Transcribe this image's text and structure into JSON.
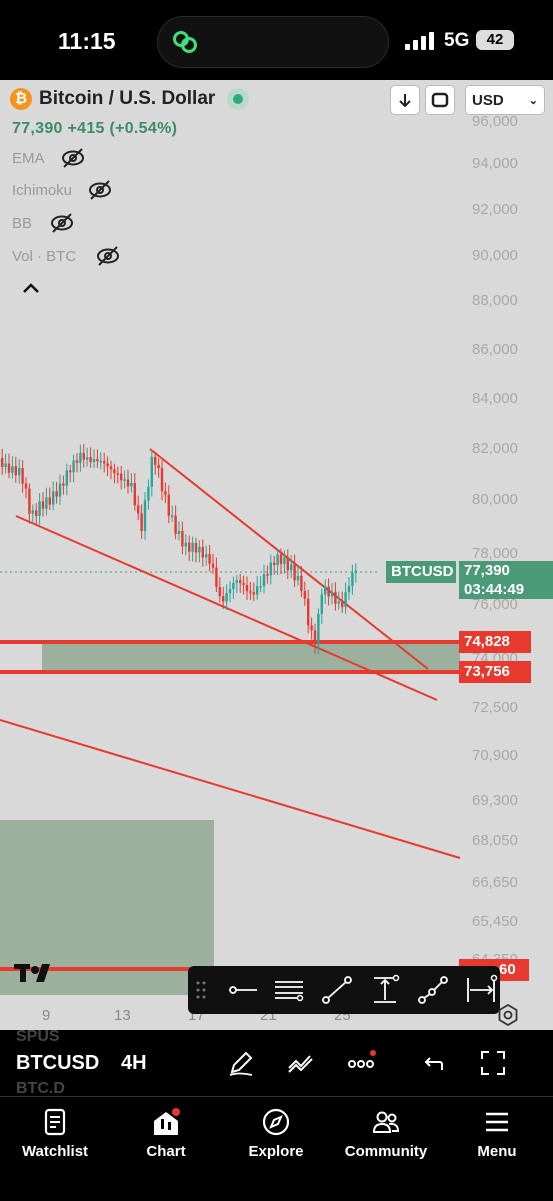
{
  "status": {
    "time": "11:15",
    "network": "5G",
    "battery": "42"
  },
  "header": {
    "symbol_title": "Bitcoin / U.S. Dollar",
    "price_line": "77,390 +415 (+0.54%)",
    "currency": "USD",
    "indicators": [
      "EMA",
      "Ichimoku",
      "BB",
      "Vol · BTC"
    ]
  },
  "price_axis": [
    "96,000",
    "94,000",
    "92,000",
    "90,000",
    "88,000",
    "86,000",
    "84,000",
    "82,000",
    "80,000",
    "78,000",
    "76,000",
    "74,000",
    "72,500",
    "70,900",
    "69,300",
    "68,050",
    "66,650",
    "65,450",
    "64,350"
  ],
  "date_axis": [
    "9",
    "13",
    "17",
    "21",
    "25"
  ],
  "tags": {
    "btcusd_label": "BTCUSD",
    "btcusd_price": "77,390",
    "countdown": "03:44:49",
    "level_1": "74,828",
    "level_2": "73,756",
    "level_3": "60"
  },
  "bottom_toolbar": {
    "symbol": "BTCUSD",
    "interval": "4H",
    "faded_above": "SPUS",
    "faded_below": "BTC.D"
  },
  "nav": [
    {
      "label": "Watchlist",
      "icon": "watchlist-icon"
    },
    {
      "label": "Chart",
      "icon": "chart-icon"
    },
    {
      "label": "Explore",
      "icon": "compass-icon"
    },
    {
      "label": "Community",
      "icon": "community-icon"
    },
    {
      "label": "Menu",
      "icon": "menu-icon"
    }
  ],
  "colors": {
    "up": "#26a69a",
    "down": "#e8392e",
    "zone": "#9bb19d",
    "line": "#e8392e",
    "accent_green": "#4a9a7a"
  }
}
